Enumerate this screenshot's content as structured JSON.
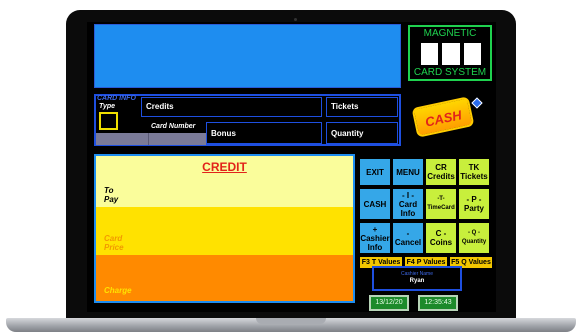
{
  "magnetic": {
    "title": "MAGNETIC",
    "footer": "CARD  SYSTEM"
  },
  "card_info": {
    "heading": "CARD INFO",
    "type_label": "Type",
    "card_number_label": "Card Number",
    "credits_label": "Credits",
    "bonus_label": "Bonus",
    "tickets_label": "Tickets",
    "quantity_label": "Quantity"
  },
  "cash_badge": {
    "text": "CASH"
  },
  "credit": {
    "title": "CREDIT",
    "to_pay": "To\nPay",
    "card_price": "Card\nPrice",
    "charge": "Charge",
    "colors": {
      "to_pay_bg": "#fafd9b",
      "card_price_bg": "#ffe200",
      "charge_bg": "#ff8a00"
    }
  },
  "buttons": [
    {
      "id": "exit",
      "label": "EXIT"
    },
    {
      "id": "menu",
      "label": "MENU"
    },
    {
      "id": "cr",
      "label": "CR\nCredits"
    },
    {
      "id": "tk",
      "label": "TK\nTickets"
    },
    {
      "id": "cash",
      "label": "CASH"
    },
    {
      "id": "card-info",
      "label": "- I -\nCard\nInfo"
    },
    {
      "id": "timecard",
      "label": "-T-\nTimeCard"
    },
    {
      "id": "party",
      "label": "- P -\nParty"
    },
    {
      "id": "cashier-info",
      "label": "+\nCashier\nInfo"
    },
    {
      "id": "cancel",
      "label": "-\nCancel"
    },
    {
      "id": "coins",
      "label": "C -\nCoins"
    },
    {
      "id": "quantity",
      "label": "- Q -\nQuantity"
    }
  ],
  "fkeys": [
    {
      "id": "f3",
      "label": "F3 T Values"
    },
    {
      "id": "f4",
      "label": "F4 P Values"
    },
    {
      "id": "f5",
      "label": "F5 Q Values"
    }
  ],
  "cashier": {
    "caption": "Cashier Name",
    "name": "Ryan"
  },
  "date": "13/12/20",
  "time": "12:35:43"
}
